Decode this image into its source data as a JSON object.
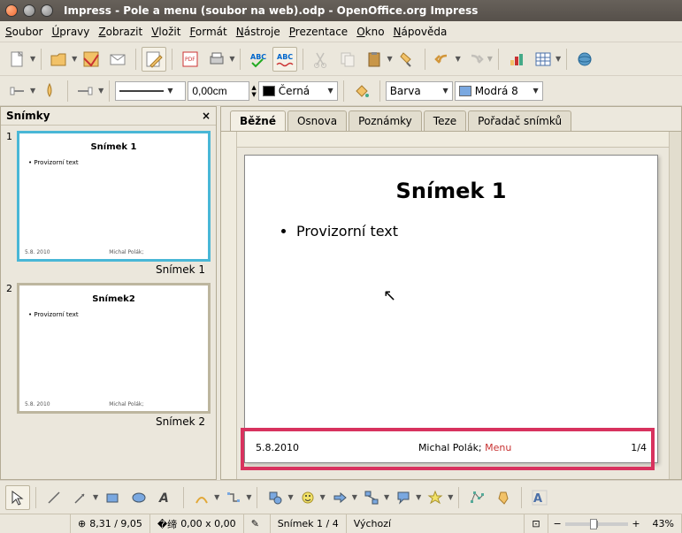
{
  "window": {
    "title": "Impress - Pole a menu (soubor na web).odp - OpenOffice.org Impress"
  },
  "menu": {
    "items": [
      "Soubor",
      "Úpravy",
      "Zobrazit",
      "Vložit",
      "Formát",
      "Nástroje",
      "Prezentace",
      "Okno",
      "Nápověda"
    ]
  },
  "toolbar2": {
    "size_value": "0,00cm",
    "color1_label": "Černá",
    "color2_label": "Barva",
    "color3_label": "Modrá 8"
  },
  "slides_panel": {
    "title": "Snímky",
    "slides": [
      {
        "num": "1",
        "title": "Snímek 1",
        "body": "• Provizorní text",
        "date": "5.8. 2010",
        "author": "Michal Polák;",
        "label": "Snímek 1"
      },
      {
        "num": "2",
        "title": "Snímek2",
        "body": "• Provizorní text",
        "date": "5.8. 2010",
        "author": "Michal Polák;",
        "label": "Snímek 2"
      }
    ]
  },
  "tabs": {
    "items": [
      "Běžné",
      "Osnova",
      "Poznámky",
      "Teze",
      "Pořadač snímků"
    ]
  },
  "slide": {
    "title": "Snímek 1",
    "bullet1": "Provizorní text",
    "footer_date": "5.8.2010",
    "footer_author": "Michal Polák; ",
    "footer_menu": "Menu",
    "footer_page": "1/4"
  },
  "status": {
    "pos": "8,31 / 9,05",
    "size": "0,00 x 0,00",
    "slide": "Snímek 1 / 4",
    "style": "Výchozí",
    "zoom": "43%"
  }
}
